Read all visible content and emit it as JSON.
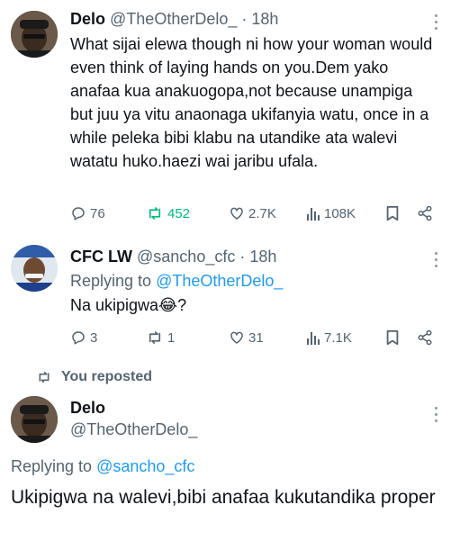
{
  "tweets": [
    {
      "name": "Delo",
      "handle": "@TheOtherDelo_",
      "time": "18h",
      "text": "What sijai elewa though ni how your woman would even think of laying hands on you.Dem yako anafaa kua anakuogopa,not because unampiga but juu ya vitu anaonaga ukifanyia watu, once in a while peleka bibi klabu na utandike ata walevi watatu huko.haezi wai jaribu ufala.",
      "replies": "76",
      "reposts": "452",
      "likes": "2.7K",
      "views": "108K"
    },
    {
      "name": "CFC LW",
      "handle": "@sancho_cfc",
      "time": "18h",
      "replying_label": "Replying to",
      "replying_to": "@TheOtherDelo_",
      "text": "Na ukipigwa😂?",
      "replies": "3",
      "reposts": "1",
      "likes": "31",
      "views": "7.1K"
    }
  ],
  "repost_banner": "You reposted",
  "main_tweet": {
    "name": "Delo",
    "handle": "@TheOtherDelo_",
    "replying_label": "Replying to",
    "replying_to": "@sancho_cfc",
    "text": "Ukipigwa na walevi,bibi anafaa kukutandika proper"
  },
  "colors": {
    "text": "#0f1419",
    "secondary": "#536471",
    "link": "#1d9bf0",
    "reposted": "#00ba7c",
    "divider": "#cfd9de"
  },
  "icons": [
    "reply-icon",
    "repost-icon",
    "like-icon",
    "views-icon",
    "bookmark-icon",
    "share-icon",
    "more-icon"
  ]
}
